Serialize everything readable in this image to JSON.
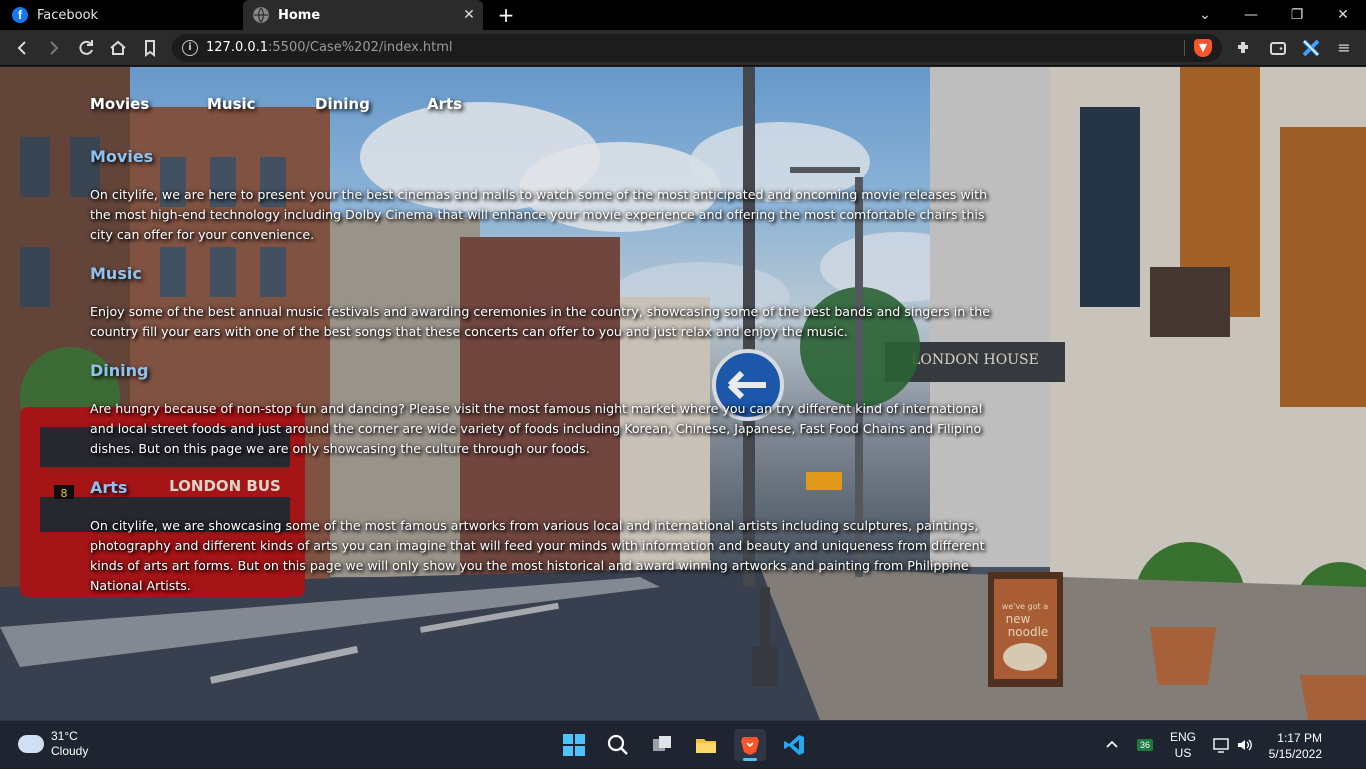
{
  "browser": {
    "tabs": [
      {
        "title": "Facebook",
        "icon": "facebook-icon",
        "active": false
      },
      {
        "title": "Home",
        "icon": "globe-icon",
        "active": true
      }
    ],
    "url_host": "127.0.0.1",
    "url_rest": ":5500/Case%202/index.html"
  },
  "nav": {
    "items": [
      "Movies",
      "Music",
      "Dining",
      "Arts"
    ]
  },
  "sections": [
    {
      "heading": "Movies",
      "body": "On citylife, we are here to present your the best cinemas and malls to watch some of the most anticipated and oncoming movie releases with the most high-end technology including Dolby Cinema that will enhance your movie experience and offering the most comfortable chairs this city can offer for your convenience."
    },
    {
      "heading": "Music",
      "body": "Enjoy some of the best annual music festivals and awarding ceremonies in the country, showcasing some of the best bands and singers in the country fill your ears with one of the best songs that these concerts can offer to you and just relax and enjoy the music."
    },
    {
      "heading": "Dining",
      "body": "Are hungry because of non-stop fun and dancing? Please visit the most famous night market where you can try different kind of international and local street foods and just around the corner are wide variety of foods including Korean, Chinese, Japanese, Fast Food Chains and Filipino dishes. But on this page we are only showcasing the culture through our foods."
    },
    {
      "heading": "Arts",
      "body": "On citylife, we are showcasing some of the most famous artworks from various local and international artists including sculptures, paintings, photography and different kinds of arts you can imagine that will feed your minds with information and beauty and uniqueness from different kinds of arts art forms. But on this page we will only show you the most historical and award winning artworks and painting from Philippine National Artists."
    }
  ],
  "background_text": {
    "bus": "LONDON BUS",
    "store": "LONDON HOUSE",
    "sign_line1": "we've got a",
    "sign_line2": "new",
    "sign_line3": "noodle",
    "bus_number": "8"
  },
  "taskbar": {
    "weather_temp": "31°C",
    "weather_desc": "Cloudy",
    "lang_line1": "ENG",
    "lang_line2": "US",
    "badge": "36",
    "time": "1:17 PM",
    "date": "5/15/2022"
  },
  "colors": {
    "heading": "#8fc2ee",
    "accent": "#4cc2ff"
  }
}
